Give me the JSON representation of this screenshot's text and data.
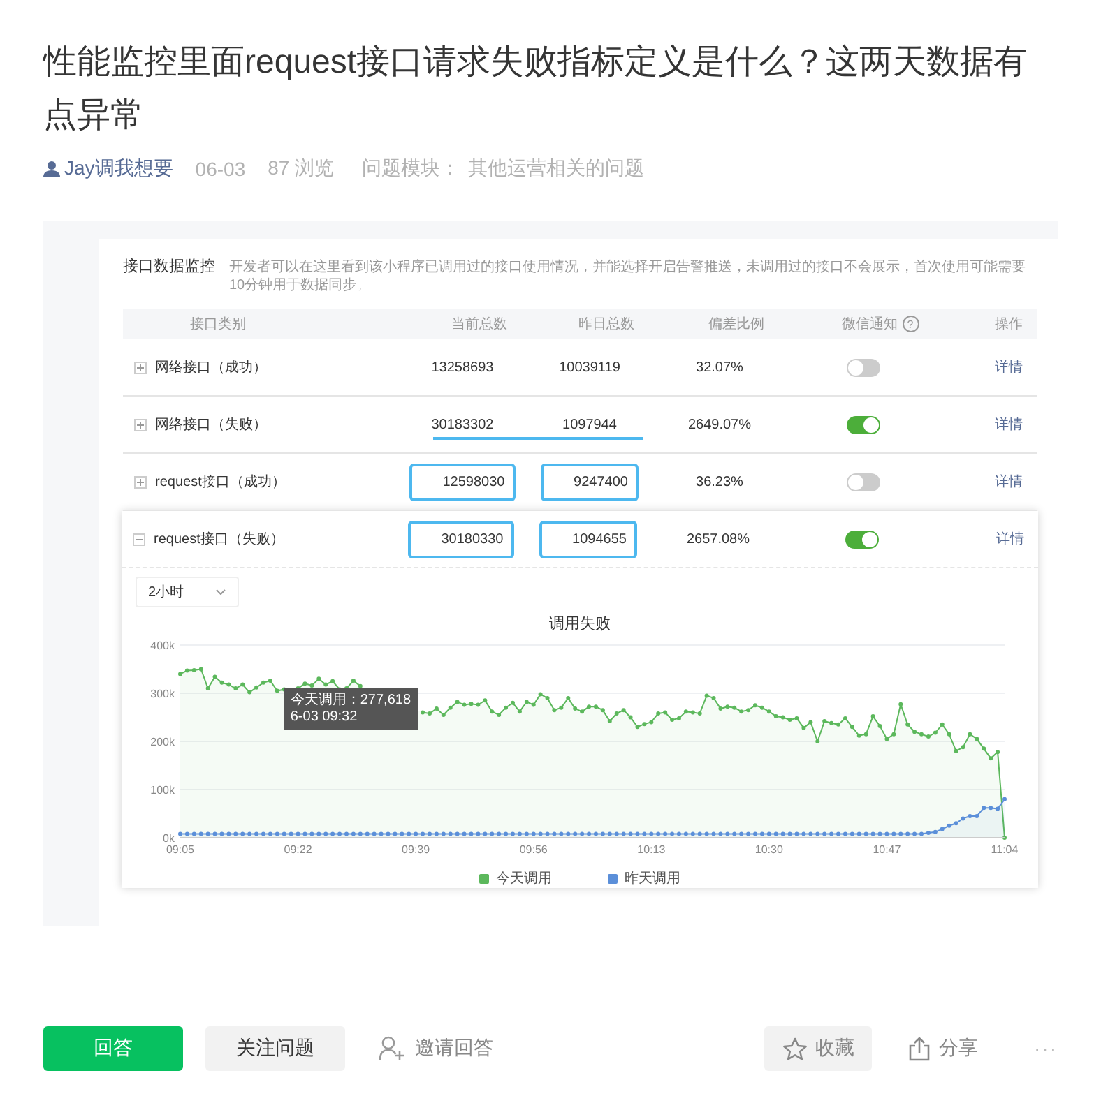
{
  "question": {
    "title": "性能监控里面request接口请求失败指标定义是什么？这两天数据有点异常"
  },
  "meta": {
    "author": "Jay调我想要",
    "date": "06-03",
    "views": "87 浏览",
    "module_label": "问题模块：",
    "module": "其他运营相关的问题"
  },
  "screenshot": {
    "panel_title": "接口数据监控",
    "description": "开发者可以在这里看到该小程序已调用过的接口使用情况，并能选择开启告警推送，未调用过的接口不会展示，首次使用可能需要10分钟用于数据同步。",
    "columns": [
      {
        "label": "接口类别"
      },
      {
        "label": "当前总数"
      },
      {
        "label": "昨日总数"
      },
      {
        "label": "偏差比例"
      },
      {
        "label": "微信通知",
        "help": "?"
      },
      {
        "label": "操作"
      }
    ],
    "rows": [
      {
        "category": "网络接口（成功）",
        "expanded": false,
        "current": {
          "value": "13258693",
          "boxed": false
        },
        "yesterday": {
          "value": "10039119",
          "boxed": false
        },
        "underlined": false,
        "ratio": "32.07%",
        "notify_on": false,
        "action": "详情"
      },
      {
        "category": "网络接口（失败）",
        "expanded": false,
        "current": {
          "value": "30183302",
          "boxed": false
        },
        "yesterday": {
          "value": "1097944",
          "boxed": false
        },
        "underlined": true,
        "ratio": "2649.07%",
        "notify_on": true,
        "action": "详情"
      },
      {
        "category": "request接口（成功）",
        "expanded": false,
        "current": {
          "value": "12598030",
          "boxed": true
        },
        "yesterday": {
          "value": "9247400",
          "boxed": true
        },
        "underlined": false,
        "ratio": "36.23%",
        "notify_on": false,
        "action": "详情"
      },
      {
        "category": "request接口（失败）",
        "expanded": true,
        "current": {
          "value": "30180330",
          "boxed": true
        },
        "yesterday": {
          "value": "1094655",
          "boxed": true
        },
        "underlined": false,
        "ratio": "2657.08%",
        "notify_on": true,
        "action": "详情"
      }
    ],
    "range_select": "2小时",
    "tooltip": {
      "label": "今天调用：277,618",
      "date": "6-03 09:32"
    },
    "chart_data": {
      "type": "area",
      "title": "调用失败",
      "categories": [
        "09:05",
        null,
        null,
        null,
        null,
        null,
        null,
        null,
        null,
        null,
        null,
        null,
        null,
        null,
        null,
        null,
        null,
        "09:22",
        null,
        null,
        null,
        null,
        null,
        null,
        null,
        null,
        null,
        null,
        null,
        null,
        null,
        null,
        null,
        null,
        "09:39",
        null,
        null,
        null,
        null,
        null,
        null,
        null,
        null,
        null,
        null,
        null,
        null,
        null,
        null,
        null,
        null,
        "09:56",
        null,
        null,
        null,
        null,
        null,
        null,
        null,
        null,
        null,
        null,
        null,
        null,
        null,
        null,
        null,
        null,
        "10:13",
        null,
        null,
        null,
        null,
        null,
        null,
        null,
        null,
        null,
        null,
        null,
        null,
        null,
        null,
        null,
        null,
        "10:30",
        null,
        null,
        null,
        null,
        null,
        null,
        null,
        null,
        null,
        null,
        null,
        null,
        null,
        null,
        null,
        null,
        "10:47",
        null,
        null,
        null,
        null,
        null,
        null,
        null,
        null,
        null,
        null,
        null,
        null,
        null,
        null,
        null,
        null,
        "11:04"
      ],
      "series": [
        {
          "name": "今天调用",
          "color": "#5cb85c",
          "marker": "circle",
          "values": [
            340,
            347,
            348,
            350,
            310,
            334,
            322,
            318,
            310,
            318,
            302,
            312,
            322,
            326,
            305,
            308,
            null,
            310,
            320,
            316,
            330,
            318,
            325,
            308,
            310,
            326,
            315,
            null,
            null,
            null,
            null,
            null,
            null,
            null,
            null,
            260,
            258,
            268,
            255,
            270,
            282,
            276,
            278,
            276,
            285,
            262,
            255,
            270,
            280,
            262,
            282,
            276,
            298,
            290,
            265,
            270,
            290,
            268,
            262,
            272,
            272,
            265,
            242,
            258,
            265,
            250,
            230,
            236,
            240,
            258,
            260,
            245,
            248,
            262,
            260,
            258,
            295,
            290,
            268,
            272,
            270,
            262,
            265,
            275,
            270,
            262,
            252,
            250,
            245,
            248,
            228,
            240,
            200,
            242,
            238,
            235,
            248,
            230,
            212,
            215,
            252,
            232,
            205,
            215,
            277,
            235,
            220,
            215,
            210,
            218,
            235,
            215,
            180,
            188,
            215,
            205,
            185,
            165,
            178,
            0
          ]
        },
        {
          "name": "昨天调用",
          "color": "#5b8fd9",
          "marker": "circle",
          "values": [
            8,
            8,
            8,
            8,
            8,
            8,
            8,
            8,
            8,
            8,
            8,
            8,
            8,
            8,
            8,
            8,
            8,
            8,
            8,
            8,
            8,
            8,
            8,
            8,
            8,
            8,
            8,
            8,
            8,
            8,
            8,
            8,
            8,
            8,
            8,
            8,
            8,
            8,
            8,
            8,
            8,
            8,
            8,
            8,
            8,
            8,
            8,
            8,
            8,
            8,
            8,
            8,
            8,
            8,
            8,
            8,
            8,
            8,
            8,
            8,
            8,
            8,
            8,
            8,
            8,
            8,
            8,
            8,
            8,
            8,
            8,
            8,
            8,
            8,
            8,
            8,
            8,
            8,
            8,
            8,
            8,
            8,
            8,
            8,
            8,
            8,
            8,
            8,
            8,
            8,
            8,
            8,
            8,
            8,
            8,
            8,
            8,
            8,
            8,
            8,
            8,
            8,
            8,
            8,
            8,
            8,
            8,
            8,
            10,
            12,
            18,
            25,
            30,
            40,
            45,
            45,
            62,
            62,
            60,
            80
          ]
        }
      ],
      "ylim": [
        0,
        400
      ],
      "grid": true,
      "yticks": [
        {
          "value": 0,
          "label": "0k"
        },
        {
          "value": 100,
          "label": "100k"
        },
        {
          "value": 200,
          "label": "200k"
        },
        {
          "value": 300,
          "label": "300k"
        },
        {
          "value": 400,
          "label": "400k"
        }
      ]
    }
  },
  "actions": {
    "answer": "回答",
    "follow": "关注问题",
    "invite": "邀请回答",
    "favorite": "收藏",
    "share": "分享",
    "more": "···"
  }
}
